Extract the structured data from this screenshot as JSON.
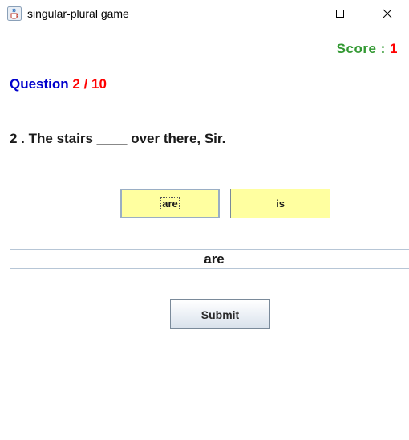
{
  "window": {
    "title": "singular-plural game",
    "icon": "java-cup-icon"
  },
  "score": {
    "label": "Score :",
    "value": "1"
  },
  "question_counter": {
    "label": "Question",
    "value": "2 / 10"
  },
  "question": {
    "text": "2 . The stairs ____ over there, Sir."
  },
  "options": [
    {
      "label": "are",
      "focused": true
    },
    {
      "label": "is",
      "focused": false
    }
  ],
  "answer": {
    "value": "are"
  },
  "submit": {
    "label": "Submit"
  },
  "colors": {
    "score_label": "#339933",
    "score_value": "#ff0000",
    "question_label": "#0000cc",
    "question_value": "#ff0000",
    "option_bg": "#ffffa0"
  }
}
